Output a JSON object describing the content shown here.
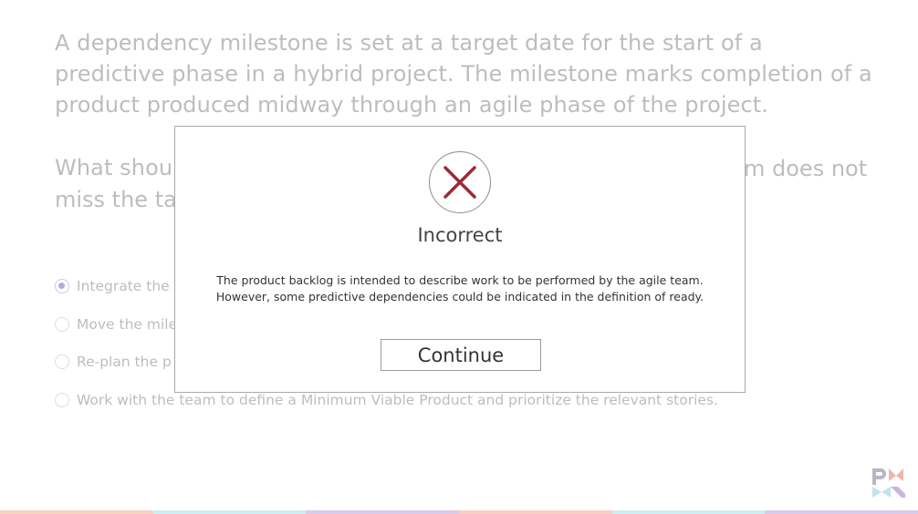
{
  "question": {
    "paragraph1": "A dependency milestone is set at a target date for the start of a predictive phase in a hybrid project. The milestone marks completion of a product produced midway through an agile phase of the project.",
    "paragraph2": "What should"
  },
  "question_line2_fragment_right": "m does not",
  "question_line3_fragment": "miss the ta",
  "options": [
    {
      "label": "Integrate the",
      "selected": true
    },
    {
      "label": "Move the mile",
      "selected": false
    },
    {
      "label": "Re-plan the p",
      "selected": false
    },
    {
      "label": "Work with the team to define a Minimum Viable Product and prioritize the relevant stories.",
      "selected": false
    }
  ],
  "feedback": {
    "icon": "x-mark-icon",
    "icon_color": "#9b2b36",
    "title": "Incorrect",
    "message_line1": "The product backlog is intended to describe work to be performed by the agile team.",
    "message_line2": "However, some predictive dependencies could be indicated in the definition of ready.",
    "button_label": "Continue"
  },
  "logo": {
    "text": "PMI",
    "colors": [
      "#b6b6c4",
      "#f3b3a8",
      "#bfe6ea",
      "#c9b4e0"
    ]
  },
  "bottom_bar_colors": [
    "#f8d1bf",
    "#cdeef3",
    "#dccaea",
    "#f9cfc4",
    "#cdeef3",
    "#dccaea"
  ]
}
